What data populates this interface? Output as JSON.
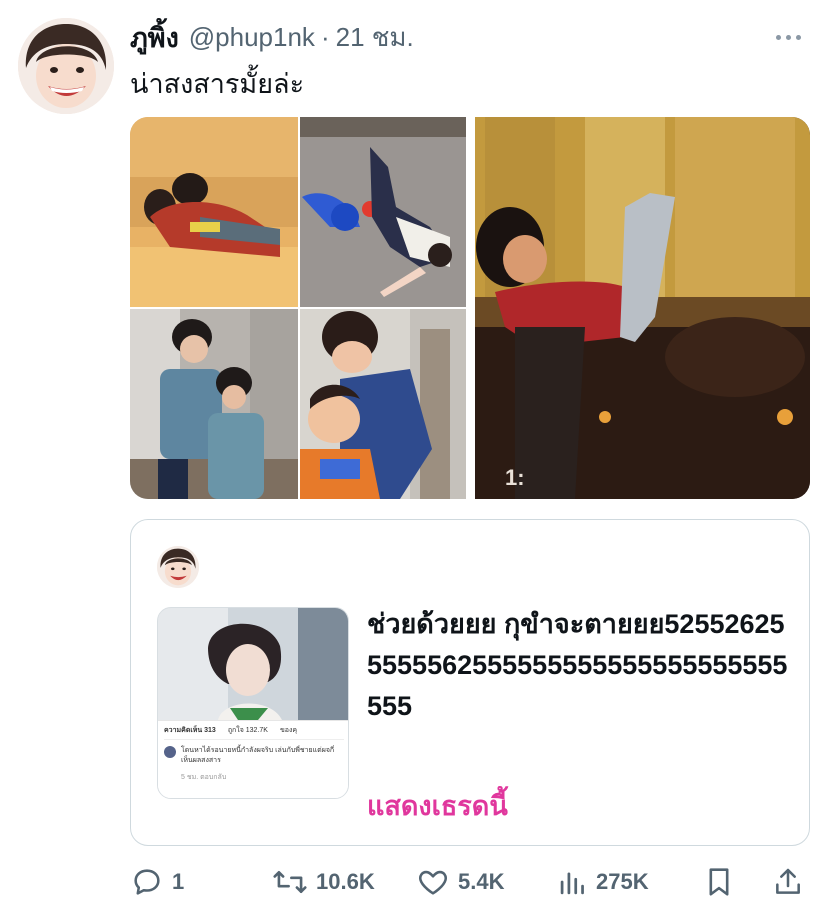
{
  "tweet": {
    "author_name": "ภูพิ้ง",
    "handle": "@phup1nk",
    "separator": "·",
    "time": "21 ชม.",
    "text": "น่าสงสารมั้ยล่ะ",
    "media_badge": "1:"
  },
  "quote": {
    "text": "ช่วยด้วยยย กุขำจะตายยย525526255555562555555555555555555555555",
    "show_thread": "แสดงเธรดนี้",
    "thumbnail": {
      "tabs": [
        "ความคิดเห็น 313",
        "ถูกใจ 132.7K",
        "ของคุ"
      ],
      "comment": "โดนหาได้รอนายหนี้กำลังผจริบ เล่นกับพี่ชายแต่ผจกี่ เห็นผลสงสาร",
      "meta": "5 ชม.   ตอบกลับ"
    }
  },
  "actions": {
    "replies": "1",
    "retweets": "10.6K",
    "likes": "5.4K",
    "views": "275K"
  },
  "icons": {
    "more": "more-icon",
    "reply": "reply-icon",
    "retweet": "retweet-icon",
    "like": "heart-icon",
    "views": "views-icon",
    "bookmark": "bookmark-icon",
    "share": "share-icon"
  },
  "colors": {
    "text": "#0f1419",
    "secondary": "#536471",
    "border": "#cfd9de",
    "link": "#e0379d"
  }
}
